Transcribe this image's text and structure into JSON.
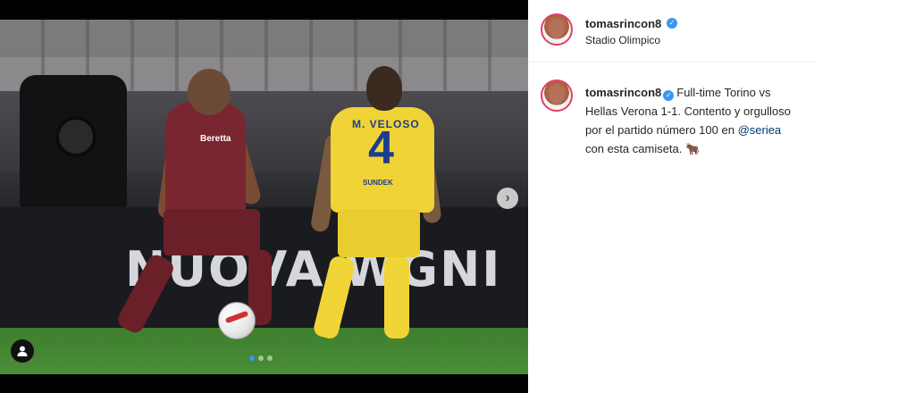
{
  "post": {
    "author": {
      "username": "tomasrincon8",
      "verified": true,
      "location": "Stadio Olimpico"
    },
    "photo": {
      "board_text": "NUOVA WGNI",
      "left_player_sponsor": "Beretta",
      "right_player_name": "M. VELOSO",
      "right_player_number": "4",
      "right_player_sponsor": "SUNDEK"
    },
    "carousel": {
      "total": 3,
      "current": 1
    },
    "caption": {
      "username": "tomasrincon8",
      "text_before_mention": "Full-time Torino vs Hellas Verona 1-1. Contento y orgulloso por el partido número 100 en ",
      "mention": "@seriea",
      "text_after_mention": " con esta camiseta. ",
      "emoji": "🐂"
    }
  },
  "icons": {
    "next": "chevron-right-icon",
    "user_tags": "user-tag-icon",
    "verified": "verified-badge-icon"
  },
  "colors": {
    "verified": "#3897f0",
    "mention": "#00376b",
    "active_dot": "#3897f0"
  }
}
